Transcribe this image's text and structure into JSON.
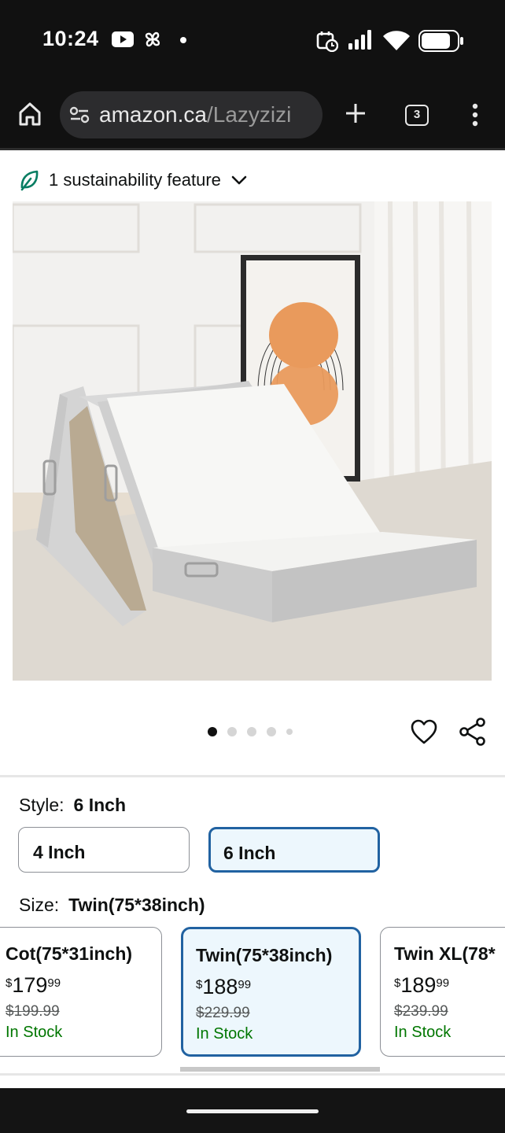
{
  "status_bar": {
    "time": "10:24",
    "left_icons": [
      "youtube-icon",
      "pinwheel-icon",
      "notification-dot-icon"
    ],
    "right_icons": [
      "calendar-clock-icon",
      "signal-icon",
      "wifi-icon",
      "battery-icon"
    ]
  },
  "browser": {
    "url_domain": "amazon.ca",
    "url_path": "/Lazyzizi",
    "tab_count": "3"
  },
  "sustainability": {
    "label": "1 sustainability feature"
  },
  "carousel": {
    "image_count": 5,
    "active_index": 0
  },
  "style": {
    "label": "Style:",
    "selected": "6 Inch",
    "options": [
      "4 Inch",
      "6 Inch"
    ]
  },
  "size": {
    "label": "Size:",
    "selected": "Twin(75*38inch)",
    "options": [
      {
        "name": "Cot(75*31inch)",
        "currency": "$",
        "price_whole": "179",
        "price_cents": "99",
        "list_price": "$199.99",
        "stock": "In Stock"
      },
      {
        "name": "Twin(75*38inch)",
        "currency": "$",
        "price_whole": "188",
        "price_cents": "99",
        "list_price": "$229.99",
        "stock": "In Stock"
      },
      {
        "name": "Twin XL(78*",
        "currency": "$",
        "price_whole": "189",
        "price_cents": "99",
        "list_price": "$239.99",
        "stock": "In Stock"
      }
    ]
  },
  "colors": {
    "selected_border": "#2162a1",
    "selected_fill": "#edf7fd",
    "in_stock": "#007600",
    "leaf_green": "#067d62"
  }
}
